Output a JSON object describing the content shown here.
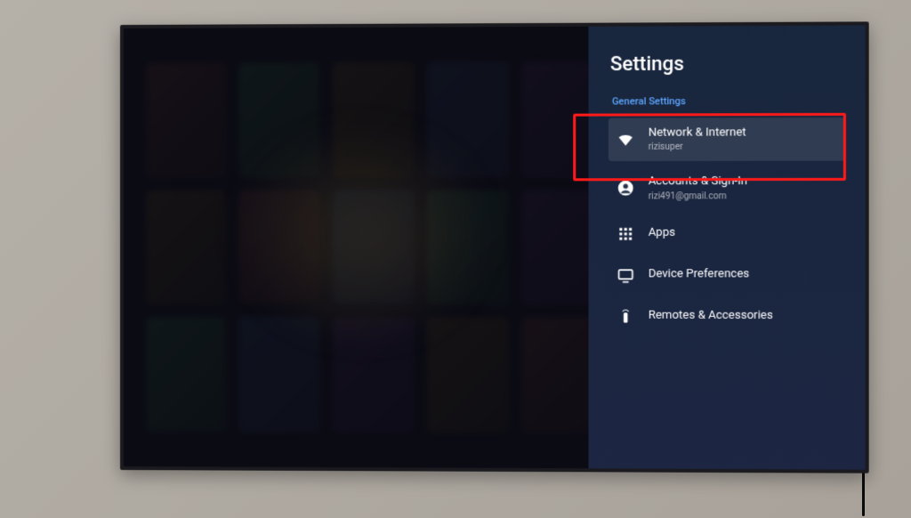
{
  "panel": {
    "title": "Settings",
    "section_label": "General Settings",
    "items": [
      {
        "icon": "wifi-icon",
        "label": "Network & Internet",
        "sub": "rizisuper",
        "selected": true
      },
      {
        "icon": "account-icon",
        "label": "Accounts & Sign-In",
        "sub": "rizi491@gmail.com",
        "selected": false
      },
      {
        "icon": "apps-icon",
        "label": "Apps",
        "sub": "",
        "selected": false
      },
      {
        "icon": "device-icon",
        "label": "Device Preferences",
        "sub": "",
        "selected": false
      },
      {
        "icon": "remote-icon",
        "label": "Remotes & Accessories",
        "sub": "",
        "selected": false
      }
    ]
  }
}
